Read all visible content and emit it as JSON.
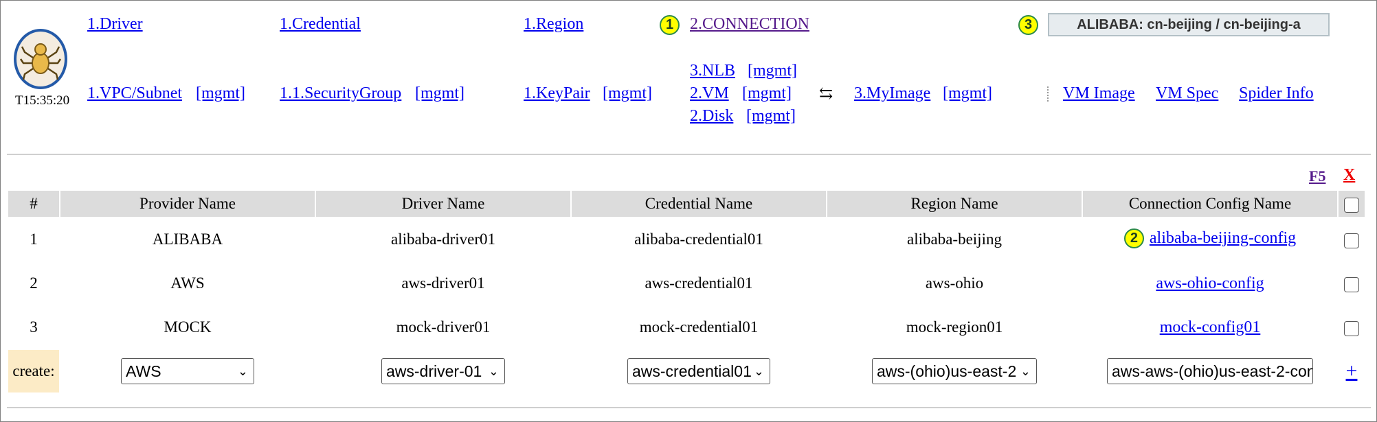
{
  "clock": "T15:35:20",
  "nav": {
    "driver": "1.Driver",
    "credential": "1.Credential",
    "region": "1.Region",
    "connection": "2.CONNECTION",
    "vpc": "1.VPC/Subnet",
    "security_group": "1.1.SecurityGroup",
    "keypair": "1.KeyPair",
    "nlb": "3.NLB",
    "vm": "2.VM",
    "disk": "2.Disk",
    "myimage": "3.MyImage",
    "mgmt": "[mgmt]",
    "swap_symbol": "⇆",
    "vm_image": "VM Image",
    "vm_spec": "VM Spec",
    "spider_info": "Spider Info"
  },
  "current_region": "ALIBABA: cn-beijing / cn-beijing-a",
  "badges": {
    "one": "1",
    "two": "2",
    "three": "3"
  },
  "actions": {
    "refresh": "F5",
    "delete": "X"
  },
  "table": {
    "headers": [
      "#",
      "Provider Name",
      "Driver Name",
      "Credential Name",
      "Region Name",
      "Connection Config Name"
    ],
    "rows": [
      {
        "num": "1",
        "provider": "ALIBABA",
        "driver": "alibaba-driver01",
        "credential": "alibaba-credential01",
        "region": "alibaba-beijing",
        "config": "alibaba-beijing-config"
      },
      {
        "num": "2",
        "provider": "AWS",
        "driver": "aws-driver01",
        "credential": "aws-credential01",
        "region": "aws-ohio",
        "config": "aws-ohio-config"
      },
      {
        "num": "3",
        "provider": "MOCK",
        "driver": "mock-driver01",
        "credential": "mock-credential01",
        "region": "mock-region01",
        "config": "mock-config01"
      }
    ],
    "create": {
      "label": "create:",
      "provider": "AWS",
      "driver": "aws-driver-01",
      "credential": "aws-credential01",
      "region": "aws-(ohio)us-east-2",
      "config_name": "aws-aws-(ohio)us-east-2-con",
      "add": "+"
    }
  }
}
